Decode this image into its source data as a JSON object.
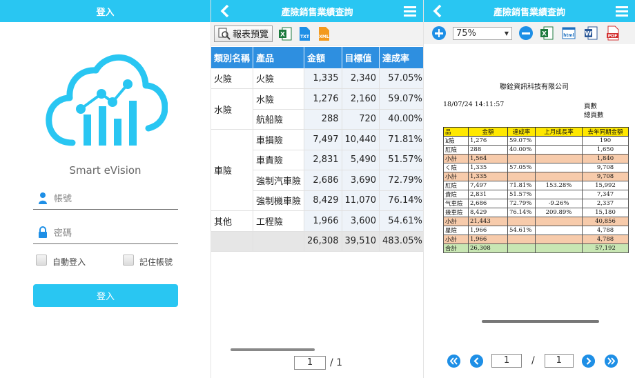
{
  "login": {
    "title": "登入",
    "app_name": "Smart eVision",
    "username_placeholder": "帳號",
    "password_placeholder": "密碼",
    "auto_login_label": "自動登入",
    "remember_label": "記住帳號",
    "login_button": "登入"
  },
  "query": {
    "title": "產險銷售業績查詢",
    "preview_button": "報表預覽",
    "columns": [
      "類別名稱",
      "產品",
      "金額",
      "目標值",
      "達成率"
    ],
    "rows": [
      {
        "cat": "火險",
        "product": "火險",
        "amount": "1,335",
        "target": "2,340",
        "rate": "57.05%"
      },
      {
        "cat": "水險",
        "product": "水險",
        "amount": "1,276",
        "target": "2,160",
        "rate": "59.07%"
      },
      {
        "cat": "",
        "product": "航船險",
        "amount": "288",
        "target": "720",
        "rate": "40.00%"
      },
      {
        "cat": "車險",
        "product": "車損險",
        "amount": "7,497",
        "target": "10,440",
        "rate": "71.81%"
      },
      {
        "cat": "",
        "product": "車責險",
        "amount": "2,831",
        "target": "5,490",
        "rate": "51.57%"
      },
      {
        "cat": "",
        "product": "強制汽車險",
        "amount": "2,686",
        "target": "3,690",
        "rate": "72.79%"
      },
      {
        "cat": "",
        "product": "強制機車險",
        "amount": "8,429",
        "target": "11,070",
        "rate": "76.14%"
      },
      {
        "cat": "其他",
        "product": "工程險",
        "amount": "1,966",
        "target": "3,600",
        "rate": "54.61%"
      }
    ],
    "total": {
      "amount": "26,308",
      "target": "39,510",
      "rate": "483.05%"
    },
    "page_current": "1",
    "page_total": "/ 1"
  },
  "preview": {
    "title": "產險銷售業績查詢",
    "zoom": "75%",
    "company": "聯銓資訊科技有限公司",
    "datetime": "18/07/24 14:11:57",
    "page_label": "頁數",
    "total_pages_label": "總頁數",
    "columns": [
      "品",
      "金額",
      "達成率",
      "上月成長率",
      "去年同期金額"
    ],
    "rows": [
      {
        "type": "row",
        "c0": "k險",
        "c1": "1,276",
        "c2": "59.07%",
        "c3": "",
        "c4": "190"
      },
      {
        "type": "row",
        "c0": "肛險",
        "c1": "288",
        "c2": "40.00%",
        "c3": "",
        "c4": "1,650"
      },
      {
        "type": "sub",
        "c0": "小計",
        "c1": "1,564",
        "c2": "",
        "c3": "",
        "c4": "1,840"
      },
      {
        "type": "row",
        "c0": "く險",
        "c1": "1,335",
        "c2": "57.05%",
        "c3": "",
        "c4": "9,708"
      },
      {
        "type": "sub",
        "c0": "小計",
        "c1": "1,335",
        "c2": "",
        "c3": "",
        "c4": "9,708"
      },
      {
        "type": "row",
        "c0": "肛險",
        "c1": "7,497",
        "c2": "71.81%",
        "c3": "153.28%",
        "c4": "15,992"
      },
      {
        "type": "row",
        "c0": "責險",
        "c1": "2,831",
        "c2": "51.57%",
        "c3": "",
        "c4": "7,347"
      },
      {
        "type": "row",
        "c0": "气車險",
        "c1": "2,686",
        "c2": "72.79%",
        "c3": "-9.26%",
        "c4": "2,337"
      },
      {
        "type": "row",
        "c0": "幾車險",
        "c1": "8,429",
        "c2": "76.14%",
        "c3": "209.89%",
        "c4": "15,180"
      },
      {
        "type": "sub",
        "c0": "小計",
        "c1": "21,443",
        "c2": "",
        "c3": "",
        "c4": "40,856"
      },
      {
        "type": "row",
        "c0": "星險",
        "c1": "1,966",
        "c2": "54.61%",
        "c3": "",
        "c4": "4,788"
      },
      {
        "type": "sub",
        "c0": "小計",
        "c1": "1,966",
        "c2": "",
        "c3": "",
        "c4": "4,788"
      },
      {
        "type": "tot",
        "c0": "合計",
        "c1": "26,308",
        "c2": "",
        "c3": "",
        "c4": "57,192"
      }
    ],
    "page_current": "1",
    "page_sep": "/",
    "page_total": "1"
  },
  "colors": {
    "header": "#29c6f2",
    "table_header": "#2e8fe0",
    "icon_blue": "#1e8fe6"
  }
}
